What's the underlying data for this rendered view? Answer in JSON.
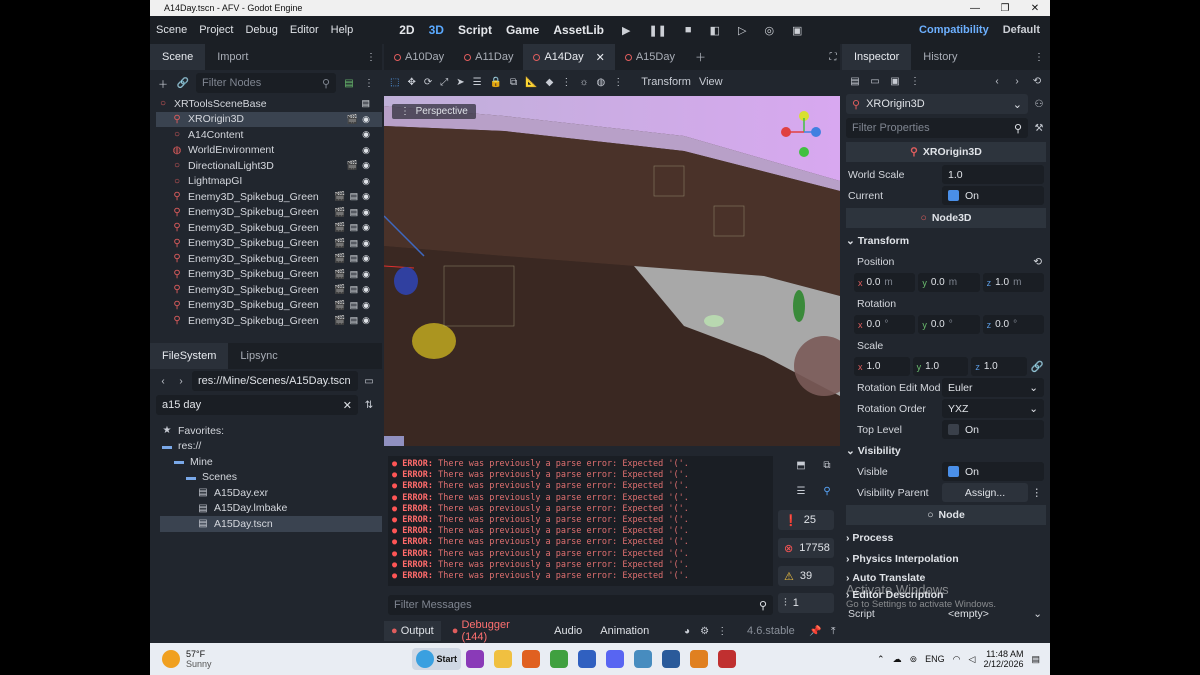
{
  "window": {
    "title": "A14Day.tscn - AFV - Godot Engine",
    "controls": [
      "—",
      "❐",
      "✕"
    ]
  },
  "menu": {
    "items": [
      "Scene",
      "Project",
      "Debug",
      "Editor",
      "Help"
    ],
    "modes": [
      "2D",
      "3D",
      "Script",
      "Game",
      "AssetLib"
    ],
    "active_mode": "3D",
    "renderer": "Compatibility",
    "layout": "Default"
  },
  "scene_panel": {
    "tabs": [
      "Scene",
      "Import"
    ],
    "filter_placeholder": "Filter Nodes",
    "tree": [
      {
        "name": "XRToolsSceneBase",
        "icon": "node-icon",
        "color": "#e05d5d"
      },
      {
        "name": "XROrigin3D",
        "icon": "xr-origin-icon",
        "color": "#e05d5d",
        "selected": true
      },
      {
        "name": "A14Content",
        "icon": "node3d-icon",
        "color": "#e05d5d"
      },
      {
        "name": "WorldEnvironment",
        "icon": "globe-icon",
        "color": "#e05d5d"
      },
      {
        "name": "DirectionalLight3D",
        "icon": "light-icon",
        "color": "#e05d5d"
      },
      {
        "name": "LightmapGI",
        "icon": "lightmap-icon",
        "color": "#e05d5d"
      },
      {
        "name": "Enemy3D_Spikebug_Green",
        "icon": "enemy-icon",
        "color": "#e05d5d"
      },
      {
        "name": "Enemy3D_Spikebug_Green",
        "icon": "enemy-icon",
        "color": "#e05d5d"
      },
      {
        "name": "Enemy3D_Spikebug_Green",
        "icon": "enemy-icon",
        "color": "#e05d5d"
      },
      {
        "name": "Enemy3D_Spikebug_Green",
        "icon": "enemy-icon",
        "color": "#e05d5d"
      },
      {
        "name": "Enemy3D_Spikebug_Green",
        "icon": "enemy-icon",
        "color": "#e05d5d"
      },
      {
        "name": "Enemy3D_Spikebug_Green",
        "icon": "enemy-icon",
        "color": "#e05d5d"
      },
      {
        "name": "Enemy3D_Spikebug_Green",
        "icon": "enemy-icon",
        "color": "#e05d5d"
      },
      {
        "name": "Enemy3D_Spikebug_Green",
        "icon": "enemy-icon",
        "color": "#e05d5d"
      },
      {
        "name": "Enemy3D_Spikebug_Green",
        "icon": "enemy-icon",
        "color": "#e05d5d"
      }
    ]
  },
  "filesystem": {
    "tabs": [
      "FileSystem",
      "Lipsync"
    ],
    "path": "res://Mine/Scenes/A15Day.tscn",
    "search": "a15 day",
    "items": [
      {
        "name": "Favorites:",
        "indent": 0,
        "icon": "star-icon"
      },
      {
        "name": "res://",
        "indent": 0,
        "icon": "folder-icon"
      },
      {
        "name": "Mine",
        "indent": 1,
        "icon": "folder-icon"
      },
      {
        "name": "Scenes",
        "indent": 2,
        "icon": "folder-icon"
      },
      {
        "name": "A15Day.exr",
        "indent": 3,
        "icon": "image-file-icon"
      },
      {
        "name": "A15Day.lmbake",
        "indent": 3,
        "icon": "file-icon"
      },
      {
        "name": "A15Day.tscn",
        "indent": 3,
        "icon": "scene-file-icon",
        "selected": true
      }
    ]
  },
  "editor": {
    "scene_tabs": [
      "A10Day",
      "A11Day",
      "A14Day",
      "A15Day"
    ],
    "active_tab": "A14Day",
    "toolbar_labels": {
      "transform": "Transform",
      "view": "View"
    },
    "viewport_label": "Perspective"
  },
  "output": {
    "lines": [
      "ERROR: There was previously a parse error: Expected '('.",
      "ERROR: There was previously a parse error: Expected '('.",
      "ERROR: There was previously a parse error: Expected '('.",
      "ERROR: There was previously a parse error: Expected '('.",
      "ERROR: There was previously a parse error: Expected '('.",
      "ERROR: There was previously a parse error: Expected '('.",
      "ERROR: There was previously a parse error: Expected '('.",
      "ERROR: There was previously a parse error: Expected '('.",
      "ERROR: There was previously a parse error: Expected '('.",
      "ERROR: There was previously a parse error: Expected '('.",
      "ERROR: There was previously a parse error: Expected '('."
    ],
    "filter_placeholder": "Filter Messages",
    "counts": {
      "messages": "25",
      "errors": "17758",
      "warnings": "39",
      "editor": "1"
    },
    "bottom_tabs": [
      "Output",
      "Debugger (144)",
      "Audio",
      "Animation"
    ],
    "version": "4.6.stable"
  },
  "inspector": {
    "tabs": [
      "Inspector",
      "History"
    ],
    "node_name": "XROrigin3D",
    "filter_placeholder": "Filter Properties",
    "class_header": "XROrigin3D",
    "world_scale": "1.0",
    "current": "On",
    "node3d_header": "Node3D",
    "transform_label": "Transform",
    "position_label": "Position",
    "position": {
      "x": "0.0",
      "y": "0.0",
      "z": "1.0",
      "unit": "m"
    },
    "rotation_label": "Rotation",
    "rotation": {
      "x": "0.0",
      "y": "0.0",
      "z": "0.0",
      "unit": "°"
    },
    "scale_label": "Scale",
    "scale": {
      "x": "1.0",
      "y": "1.0",
      "z": "1.0"
    },
    "rotation_edit_mode_label": "Rotation Edit Mod",
    "rotation_edit_mode": "Euler",
    "rotation_order_label": "Rotation Order",
    "rotation_order": "YXZ",
    "top_level_label": "Top Level",
    "top_level": "On",
    "visibility_label": "Visibility",
    "visible_label": "Visible",
    "visible": "On",
    "visibility_parent_label": "Visibility Parent",
    "visibility_parent": "Assign...",
    "node_header": "Node",
    "sections": [
      "Process",
      "Physics Interpolation",
      "Auto Translate",
      "Editor Description"
    ],
    "script_label": "Script",
    "script_value": "<empty>",
    "world_scale_label": "World Scale",
    "current_label": "Current",
    "watermark_1": "Activate Windows",
    "watermark_2": "Go to Settings to activate Windows."
  },
  "taskbar": {
    "weather_temp": "57°F",
    "weather_desc": "Sunny",
    "start_label": "Start",
    "lang": "ENG",
    "time": "11:48 AM",
    "date": "2/12/2026"
  }
}
